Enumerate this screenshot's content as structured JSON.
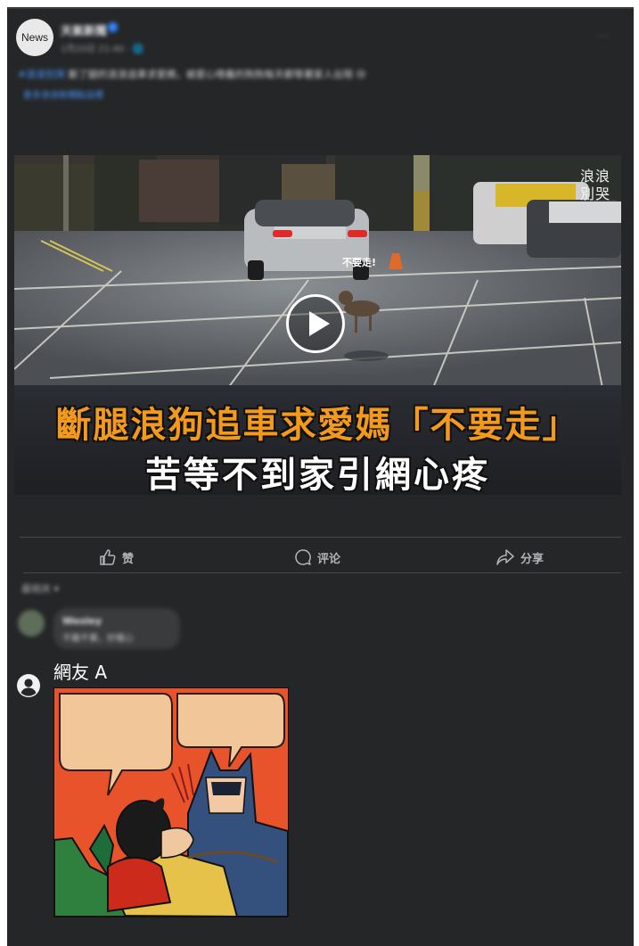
{
  "header": {
    "avatar_text": "News",
    "page_name": "天氣新聞",
    "post_meta": "1月20日 21:40 · 🌐",
    "more_label": "···"
  },
  "caption": {
    "hashtag": "#浪浪別哭",
    "text": " 斷了腿的浪浪追車求愛媽，被愛心喂養的狗狗每天都等著家人出現 😢",
    "link": "更多浪浪新聞點這裡"
  },
  "video": {
    "watermark_line1": "浪浪",
    "watermark_line2": "別哭",
    "dog_label": "不要走!",
    "headline_line1": "斷腿浪狗追車求愛媽「不要走」",
    "headline_line2": "苦等不到家引網心疼"
  },
  "actions": {
    "like_label": "赞",
    "comment_label": "评论",
    "share_label": "分享"
  },
  "comments": {
    "sort_label": "最相关 ▾",
    "blurred_comment": {
      "name": "Wesley",
      "text": "不離不棄，好暖心"
    },
    "comment_a": {
      "author": "網友 A"
    }
  },
  "colors": {
    "card_bg": "#252628",
    "headline_orange": "#f39a1d",
    "link_blue": "#4599ff"
  }
}
